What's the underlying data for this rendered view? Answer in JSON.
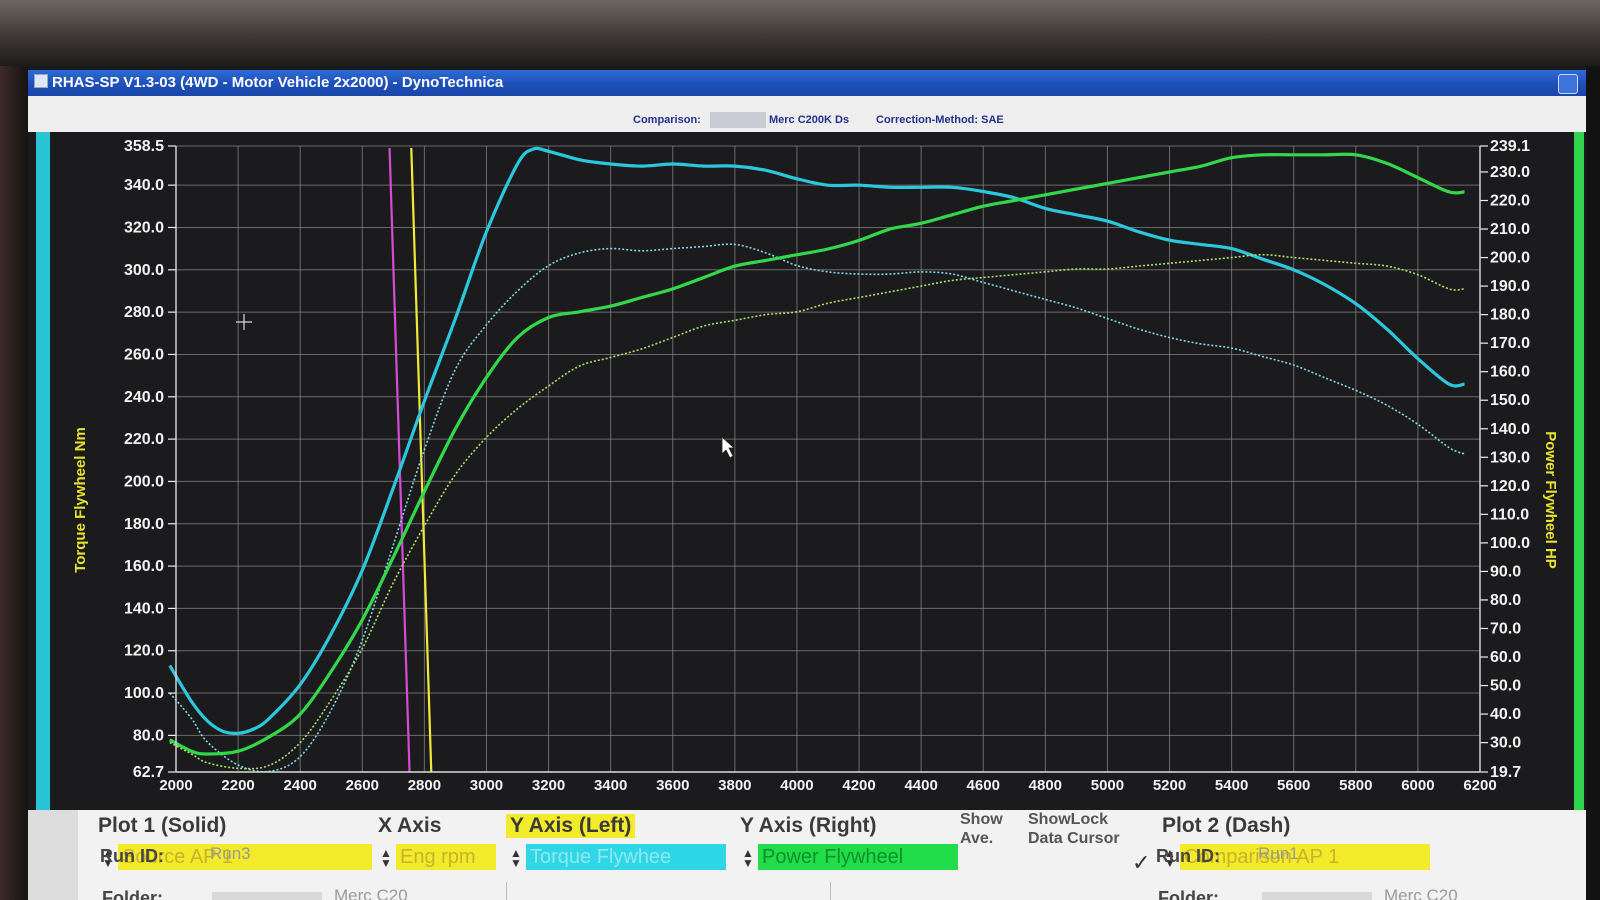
{
  "window": {
    "title": "RHAS-SP V1.3-03  (4WD - Motor Vehicle 2x2000) - DynoTechnica"
  },
  "infobar": {
    "comparison_label": "Comparison:",
    "comparison_value": "Merc C200K Ds",
    "correction": "Correction-Method: SAE"
  },
  "chart_data": {
    "type": "line",
    "x_ticks": [
      "2000",
      "2200",
      "2400",
      "2600",
      "2800",
      "3000",
      "3200",
      "3400",
      "3600",
      "3800",
      "4000",
      "4200",
      "4400",
      "4600",
      "4800",
      "5000",
      "5200",
      "5400",
      "5600",
      "5800",
      "6000",
      "6200"
    ],
    "xlim": [
      2000,
      6200
    ],
    "ylabel_left": "Torque Flywheel Nm",
    "ylabel_right": "Power Flywheel HP",
    "ylim_left": [
      62.7,
      358.5
    ],
    "ylim_right": [
      19.7,
      239.1
    ],
    "y_left_ticks": [
      "358.5",
      "340.0",
      "320.0",
      "300.0",
      "280.0",
      "260.0",
      "240.0",
      "220.0",
      "200.0",
      "180.0",
      "160.0",
      "140.0",
      "120.0",
      "100.0",
      "80.0",
      "62.7"
    ],
    "y_right_ticks": [
      "239.1",
      "230.0",
      "220.0",
      "210.0",
      "200.0",
      "190.0",
      "180.0",
      "170.0",
      "160.0",
      "150.0",
      "140.0",
      "130.0",
      "120.0",
      "110.0",
      "100.0",
      "90.0",
      "80.0",
      "70.0",
      "60.0",
      "50.0",
      "40.0",
      "30.0",
      "19.7"
    ],
    "grid": true,
    "markers": [
      {
        "x": 2720,
        "color": "#d64bd6"
      },
      {
        "x": 2790,
        "color": "#f2e838"
      }
    ],
    "series": [
      {
        "axis": "left",
        "style": "solid",
        "color": "#2bc7dc",
        "x": [
          1980,
          2050,
          2100,
          2150,
          2200,
          2250,
          2300,
          2400,
          2500,
          2600,
          2700,
          2800,
          2900,
          3000,
          3100,
          3150,
          3200,
          3300,
          3400,
          3500,
          3600,
          3700,
          3800,
          3900,
          4000,
          4100,
          4200,
          4300,
          4400,
          4500,
          4600,
          4700,
          4800,
          4900,
          5000,
          5100,
          5200,
          5300,
          5400,
          5500,
          5600,
          5700,
          5800,
          5900,
          6000,
          6100,
          6150
        ],
        "y": [
          113,
          96,
          87,
          82,
          81,
          83,
          88,
          104,
          128,
          158,
          197,
          238,
          277,
          318,
          350,
          357,
          356,
          352,
          350,
          349,
          350,
          349,
          349,
          347,
          343,
          340,
          340,
          339,
          339,
          339,
          337,
          334,
          329,
          326,
          323,
          318,
          314,
          312,
          310,
          305,
          300,
          293,
          284,
          272,
          258,
          246,
          246
        ]
      },
      {
        "axis": "left",
        "style": "dashed",
        "color": "#7fd8e8",
        "x": [
          1980,
          2050,
          2100,
          2200,
          2300,
          2400,
          2500,
          2600,
          2700,
          2800,
          2900,
          3000,
          3100,
          3200,
          3300,
          3400,
          3500,
          3600,
          3700,
          3800,
          3900,
          4000,
          4100,
          4200,
          4300,
          4400,
          4500,
          4600,
          4700,
          4800,
          4900,
          5000,
          5100,
          5200,
          5300,
          5400,
          5500,
          5600,
          5700,
          5800,
          5900,
          6000,
          6100,
          6150
        ],
        "y": [
          100,
          88,
          77,
          66,
          63,
          70,
          92,
          125,
          170,
          215,
          253,
          274,
          290,
          302,
          308,
          310,
          309,
          310,
          311,
          312,
          308,
          302,
          299,
          298,
          298,
          299,
          298,
          294,
          290,
          286,
          282,
          277,
          272,
          268,
          265,
          263,
          259,
          255,
          249,
          243,
          236,
          227,
          216,
          213
        ]
      },
      {
        "axis": "right",
        "style": "solid",
        "color": "#32d84a",
        "x": [
          1980,
          2050,
          2100,
          2200,
          2300,
          2400,
          2500,
          2600,
          2700,
          2800,
          2900,
          3000,
          3100,
          3200,
          3300,
          3400,
          3500,
          3600,
          3700,
          3800,
          3900,
          4000,
          4100,
          4200,
          4300,
          4400,
          4500,
          4600,
          4700,
          4800,
          4900,
          5000,
          5100,
          5200,
          5300,
          5400,
          5500,
          5600,
          5700,
          5800,
          5900,
          6000,
          6100,
          6150
        ],
        "y": [
          31,
          27,
          26,
          27,
          32,
          40,
          55,
          73,
          95,
          118,
          140,
          158,
          172,
          179,
          181,
          183,
          186,
          189,
          193,
          197,
          199,
          201,
          203,
          206,
          210,
          212,
          215,
          218,
          220,
          222,
          224,
          226,
          228,
          230,
          232,
          235,
          236,
          236,
          236,
          236,
          233,
          228,
          223,
          223
        ]
      },
      {
        "axis": "right",
        "style": "dashed",
        "color": "#a9e26a",
        "x": [
          1980,
          2050,
          2100,
          2200,
          2300,
          2400,
          2500,
          2600,
          2700,
          2800,
          2900,
          3000,
          3100,
          3200,
          3300,
          3400,
          3500,
          3600,
          3700,
          3800,
          3900,
          4000,
          4100,
          4200,
          4300,
          4400,
          4500,
          4600,
          4700,
          4800,
          4900,
          5000,
          5100,
          5200,
          5300,
          5400,
          5500,
          5600,
          5700,
          5800,
          5900,
          6000,
          6100,
          6150
        ],
        "y": [
          30,
          26,
          23,
          21,
          22,
          30,
          45,
          63,
          86,
          106,
          124,
          137,
          147,
          155,
          162,
          165,
          168,
          172,
          176,
          178,
          180,
          181,
          184,
          186,
          188,
          190,
          192,
          193,
          194,
          195,
          196,
          196,
          197,
          198,
          199,
          200,
          201,
          200,
          199,
          198,
          197,
          194,
          189,
          189
        ]
      }
    ]
  },
  "panel": {
    "plot1_header": "Plot 1 (Solid)",
    "xaxis_header": "X Axis",
    "yleft_header": "Y Axis (Left)",
    "yright_header": "Y Axis (Right)",
    "show_ave": "Show\nAve.",
    "show_lock": "ShowLock\nData Cursor",
    "plot2_header": "Plot 2 (Dash)",
    "plot1_source": "Source AP 1",
    "xaxis_value": "Eng rpm",
    "yleft_value": "Torque Flywhee",
    "yright_value": "Power Flywheel",
    "plot2_source": "Comparison AP 1",
    "folder_label": "Folder:",
    "folder1_value": "Merc C20",
    "runid_label": "Run ID:",
    "run1_value": "Run3",
    "folder2_value": "Merc C20",
    "run2_value": "Run1",
    "check_glyph": "✓",
    "colors": {
      "yellow": "#f3ea2a",
      "cyan": "#2fd6e6",
      "green": "#22dd4a"
    }
  }
}
